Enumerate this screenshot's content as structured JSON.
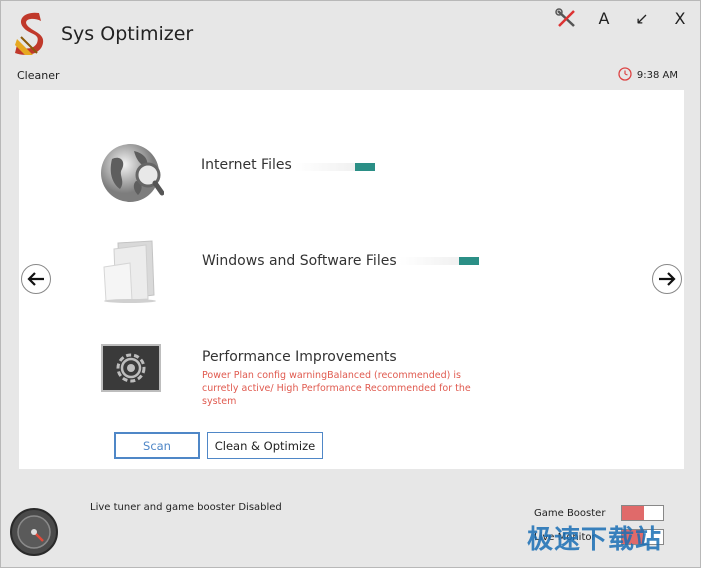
{
  "window": {
    "title": "Sys Optimizer",
    "controls": [
      {
        "name": "tools-icon",
        "glyph": ""
      },
      {
        "name": "font-icon",
        "glyph": "A"
      },
      {
        "name": "minimize-icon",
        "glyph": "↙"
      },
      {
        "name": "close-icon",
        "glyph": "X"
      }
    ]
  },
  "section": {
    "label": "Cleaner"
  },
  "clock": {
    "time": "9:38 AM"
  },
  "items": [
    {
      "label": "Internet Files",
      "icon": "globe-magnifier-icon",
      "progress": 0.25
    },
    {
      "label": "Windows and Software Files",
      "icon": "folder-icon",
      "progress": 0.25
    },
    {
      "label": "Performance Improvements",
      "icon": "gear-monitor-icon"
    }
  ],
  "warning": {
    "text": "Power Plan config warningBalanced (recommended) is curretly active/ High Performance Recommended for the system"
  },
  "buttons": {
    "scan": "Scan",
    "clean": "Clean & Optimize"
  },
  "status": {
    "text": "Live tuner and game booster Disabled"
  },
  "toggles": [
    {
      "label": "Game Booster",
      "state": "off",
      "color": "#e06a6a"
    },
    {
      "label": "Live Monitor",
      "state": "off",
      "color": "#e06a6a"
    }
  ],
  "watermark": {
    "text": "极速下载站"
  },
  "colors": {
    "accent": "#2b8f86",
    "warning": "#e05a4f",
    "button_border": "#4f87c7"
  }
}
